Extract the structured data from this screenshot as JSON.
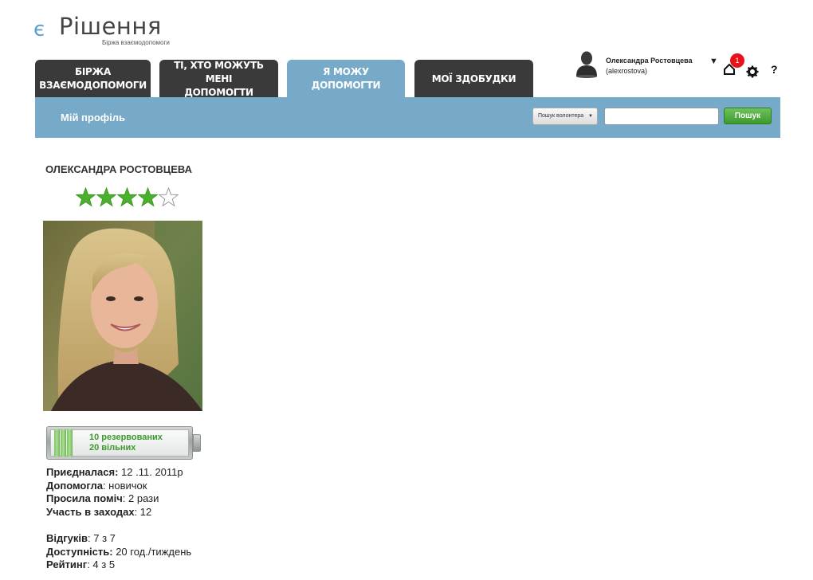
{
  "logo": {
    "prefix": "є",
    "name": "Рішення",
    "tagline": "Біржа взаємодопомоги",
    "accent_color": "#5f9fcf"
  },
  "tabs": [
    {
      "line1": "БІРЖА",
      "line2": "ВЗАЄМОДОПОМОГИ",
      "active": false
    },
    {
      "line1": "ТІ, ХТО МОЖУТЬ МЕНІ",
      "line2": "ДОПОМОГТИ",
      "active": false
    },
    {
      "line1": "Я МОЖУ ДОПОМОГТИ",
      "line2": "",
      "active": true
    },
    {
      "line1": "МОЇ ЗДОБУДКИ",
      "line2": "",
      "active": false
    }
  ],
  "user": {
    "name": "Олександра Ростовцева",
    "login": "(alexrostova)",
    "notifications": "1",
    "help": "?"
  },
  "bar": {
    "title": "Мій профіль",
    "search_select": "Пошук волонтера",
    "search_value": "",
    "search_button": "Пошук",
    "color": "#77a9c9"
  },
  "profile": {
    "name": "ОЛЕКСАНДРА РОСТОВЦЕВА",
    "rating_stars": 4,
    "max_stars": 5,
    "battery": {
      "reserved": "10 резервованих",
      "free": "20 вільних",
      "fill_fraction": 0.33
    },
    "stats": [
      {
        "label": "Приєдналася:",
        "value": " 12 .11. 2011р"
      },
      {
        "label": "Допомогла",
        "value": ": новичок"
      },
      {
        "label": "Просила поміч",
        "value": ": 2 рази"
      },
      {
        "label": "Участь в заходах",
        "value": ": 12"
      }
    ],
    "stats2": [
      {
        "label": "Відгуків",
        "value": ": 7 з 7"
      },
      {
        "label": "Доступність:",
        "value": " 20 год./тиждень"
      },
      {
        "label": "Рейтинг",
        "value": ": 4 з 5"
      }
    ]
  }
}
